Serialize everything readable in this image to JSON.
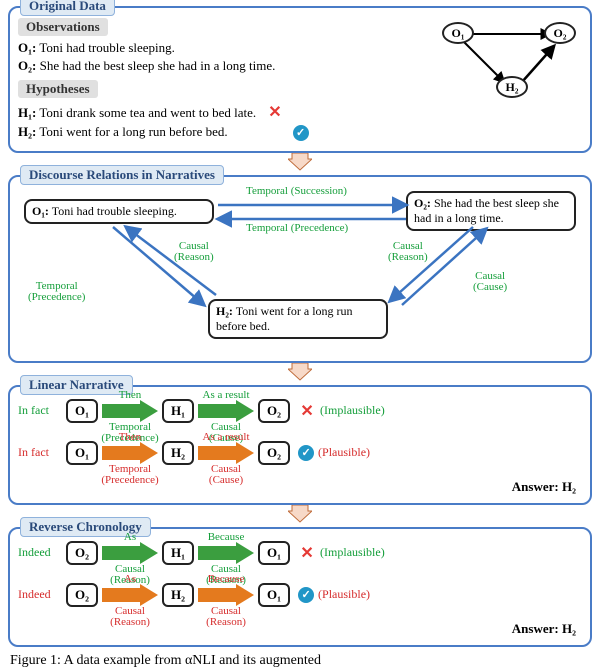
{
  "sections": {
    "original": {
      "title": "Original Data",
      "obs_label": "Observations",
      "hyp_label": "Hypotheses",
      "o1_tag": "O₁:",
      "o1_text": " Toni had trouble sleeping.",
      "o2_tag": "O₂:",
      "o2_text": " She had the best sleep she had in a long time.",
      "h1_tag": "H₁:",
      "h1_text": " Toni drank some tea and went to bed late.",
      "h2_tag": "H₂:",
      "h2_text": " Toni went for a long run before bed.",
      "graph": {
        "n1": "O₁",
        "n2": "O₂",
        "n3": "H₂"
      }
    },
    "discourse": {
      "title": "Discourse Relations in Narratives",
      "box_o1_tag": "O₁:",
      "box_o1_text": " Toni had trouble sleeping.",
      "box_o2_tag": "O₂:",
      "box_o2_text": " She had the best sleep she had in a long time.",
      "box_h2_tag": "H₂:",
      "box_h2_text": " Toni went for a long run before bed.",
      "rel_top_fwd": "Temporal (Succession)",
      "rel_top_bwd": "Temporal (Precedence)",
      "rel_left_up": "Temporal\n(Precedence)",
      "rel_left_dn": "Causal\n(Reason)",
      "rel_right_up": "Causal\n(Reason)",
      "rel_right_dn": "Causal\n(Cause)"
    },
    "linear": {
      "title": "Linear Narrative",
      "row1_lead": "In fact",
      "row1_c1": "O₁",
      "row1_a1_top": "Then",
      "row1_a1_bot": "Temporal\n(Precedence)",
      "row1_c2": "H₁",
      "row1_a2_top": "As a result",
      "row1_a2_bot": "Causal\n(Cause)",
      "row1_c3": "O₂",
      "row1_res": "(Implausible)",
      "row2_lead": "In fact",
      "row2_c1": "O₁",
      "row2_a1_top": "Then",
      "row2_a1_bot": "Temporal\n(Precedence)",
      "row2_c2": "H₂",
      "row2_a2_top": "As a result",
      "row2_a2_bot": "Causal\n(Cause)",
      "row2_c3": "O₂",
      "row2_res": "(Plausible)",
      "answer": "Answer: H₂"
    },
    "reverse": {
      "title": "Reverse Chronology",
      "row1_lead": "Indeed",
      "row1_c1": "O₂",
      "row1_a1_top": "As",
      "row1_a1_bot": "Causal\n(Reason)",
      "row1_c2": "H₁",
      "row1_a2_top": "Because",
      "row1_a2_bot": "Causal\n(Reason)",
      "row1_c3": "O₁",
      "row1_res": "(Implausible)",
      "row2_lead": "Indeed",
      "row2_c1": "O₂",
      "row2_a1_top": "As",
      "row2_a1_bot": "Causal\n(Reason)",
      "row2_c2": "H₂",
      "row2_a2_top": "Because",
      "row2_a2_bot": "Causal\n(Reason)",
      "row2_c3": "O₁",
      "row2_res": "(Plausible)",
      "answer": "Answer: H₂"
    }
  },
  "caption": "Figure 1: A data example from αNLI and its augmented"
}
